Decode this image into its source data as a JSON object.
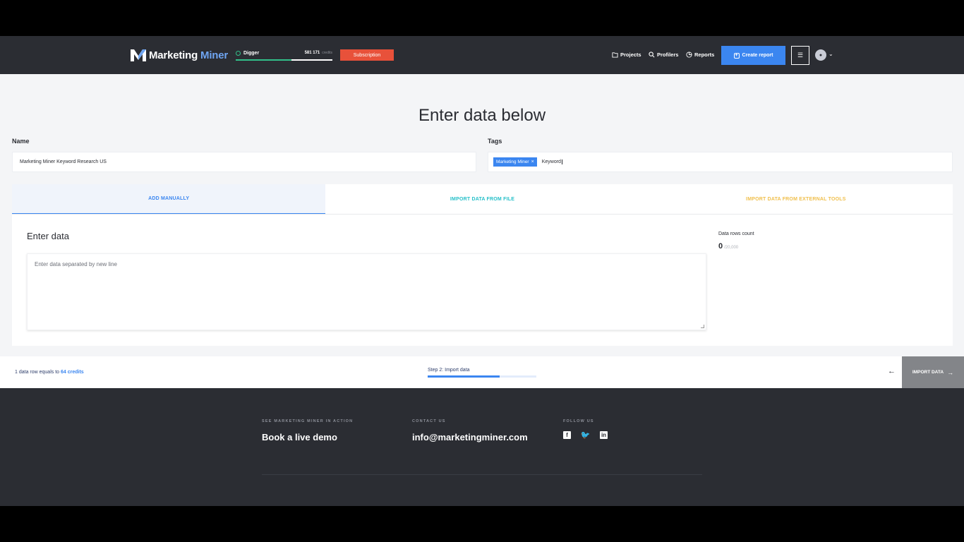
{
  "header": {
    "logo": {
      "part1": "Marketing",
      "part2": "Miner"
    },
    "plan": {
      "name": "Digger",
      "credits": "581 171",
      "credits_unit": "credits",
      "progress": 0.58
    },
    "subscription_label": "Subscription",
    "nav": {
      "projects": "Projects",
      "profilers": "Profilers",
      "reports": "Reports"
    },
    "create_report_label": "Create report",
    "colors": {
      "bg": "#2b2d33",
      "accent": "#3b86f0",
      "subscription": "#e8513a",
      "credits_bar": "#32c08a"
    }
  },
  "main": {
    "title": "Enter data below",
    "name_label": "Name",
    "name_value": "Marketing Miner Keyword Research US",
    "tags_label": "Tags",
    "tags": [
      {
        "label": "Marketing Miner"
      }
    ],
    "tag_input_value": "Keyword",
    "tabs": [
      {
        "label": "ADD MANUALLY",
        "active": true
      },
      {
        "label": "IMPORT DATA FROM FILE",
        "active": false
      },
      {
        "label": "IMPORT DATA FROM EXTERNAL TOOLS",
        "active": false
      }
    ],
    "enter_data_title": "Enter data",
    "textarea_placeholder": "Enter data separated by new line",
    "rows_count_label": "Data rows count",
    "rows_count": "0",
    "rows_max": "/20,000"
  },
  "bottom_bar": {
    "credit_prefix": "1 data row equals to ",
    "credit_value": "64 credits",
    "step_label": "Step 2: Import data",
    "step_progress": 0.66,
    "import_label": "IMPORT DATA"
  },
  "footer": {
    "demo_caption": "SEE MARKETING MINER IN ACTION",
    "demo_value": "Book a live demo",
    "contact_caption": "CONTACT US",
    "contact_value": "info@marketingminer.com",
    "follow_caption": "FOLLOW US",
    "socials": [
      "facebook-icon",
      "twitter-icon",
      "linkedin-icon"
    ]
  }
}
